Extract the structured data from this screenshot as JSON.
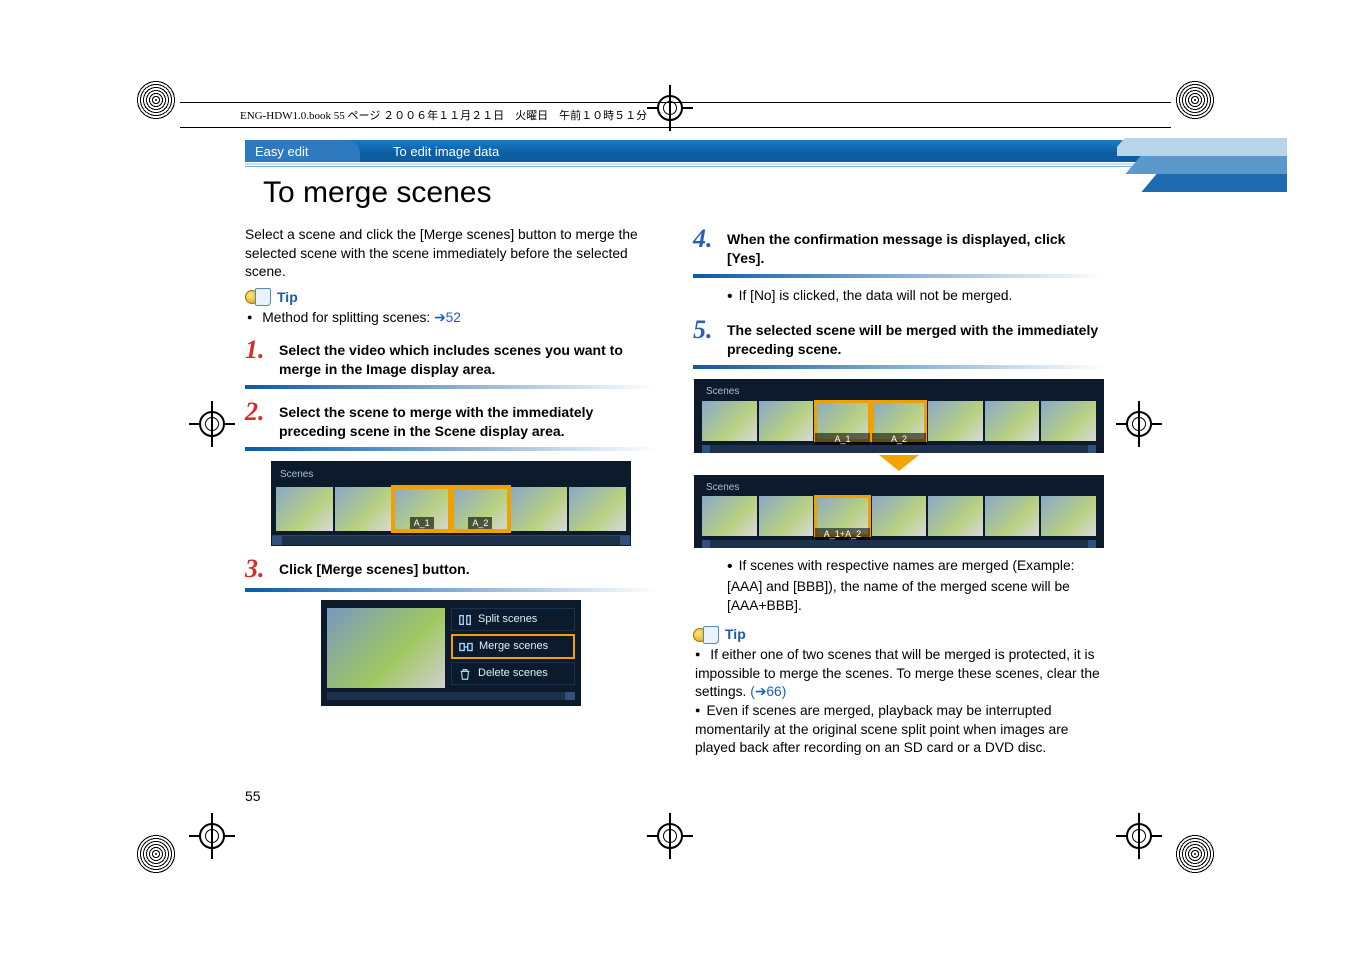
{
  "file_header": "ENG-HDW1.0.book  55 ページ  ２００６年１１月２１日　火曜日　午前１０時５１分",
  "breadcrumb": {
    "section": "Easy edit",
    "subsection": "To edit image data"
  },
  "title": "To merge scenes",
  "intro": "Select a scene and click the [Merge scenes] button to merge the selected scene with the scene immediately before the selected scene.",
  "tip_label": "Tip",
  "tip1_bullet_prefix": "Method for splitting scenes: ",
  "tip1_link": "➔52",
  "steps": {
    "1": "Select the video which includes scenes you want to merge in the Image display area.",
    "2": "Select the scene to merge with the immediately preceding scene in the Scene display area.",
    "3": "Click [Merge scenes] button.",
    "4": "When the confirmation message is displayed, click [Yes].",
    "4_sub": "If [No] is clicked, the data will not be merged.",
    "5": "The selected scene will be merged with the immediately preceding scene.",
    "5_sub": "If scenes with respective names are merged (Example: [AAA] and [BBB]), the name of the merged scene will be [AAA+BBB]."
  },
  "scene_panel_label": "Scenes",
  "scene_labels_before": [
    "A_1",
    "A_2"
  ],
  "scene_label_after": "A_1+A_2",
  "menu": {
    "split": "Split scenes",
    "merge": "Merge scenes",
    "delete": "Delete scenes"
  },
  "right_tips": {
    "b1": "If either one of two scenes that will be merged is protected, it is impossible to merge the scenes. To merge these scenes, clear the settings. ",
    "b1_link": "(➔66)",
    "b2": "Even if scenes are merged, playback may be interrupted momentarily at the original scene split point when images are played back after recording on an SD card or a DVD disc."
  },
  "page_number": "55"
}
